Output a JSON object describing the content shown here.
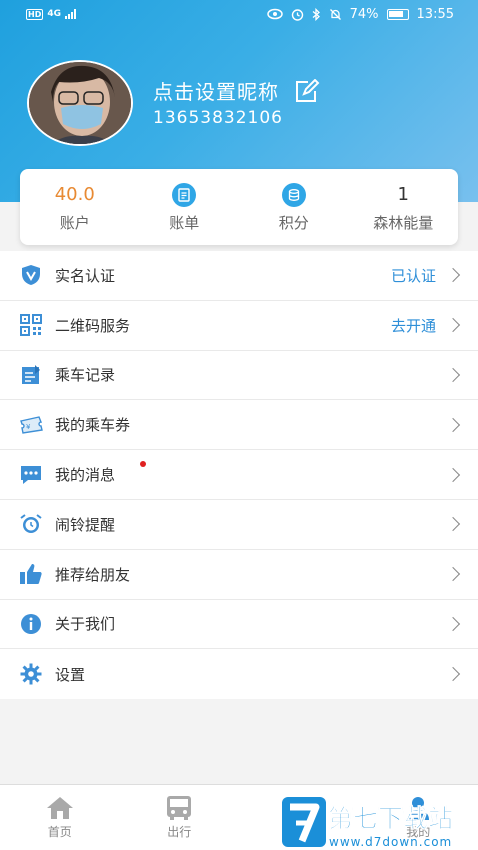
{
  "status_bar": {
    "network": "4G",
    "hd": "HD",
    "battery": "74%",
    "time": "13:55"
  },
  "profile": {
    "nickname": "点击设置昵称",
    "phone": "13653832106"
  },
  "stats": [
    {
      "value": "40.0",
      "label": "账户"
    },
    {
      "label": "账单",
      "icon": "receipt-icon"
    },
    {
      "label": "积分",
      "icon": "coins-icon"
    },
    {
      "value": "1",
      "label": "森林能量"
    }
  ],
  "menu": [
    {
      "label": "实名认证",
      "status": "已认证",
      "icon": "shield-v-icon"
    },
    {
      "label": "二维码服务",
      "status": "去开通",
      "icon": "qr-code-icon"
    },
    {
      "label": "乘车记录",
      "icon": "notebook-icon"
    },
    {
      "label": "我的乘车券",
      "icon": "ticket-icon"
    },
    {
      "label": "我的消息",
      "icon": "message-icon",
      "has_unread_dot": true
    },
    {
      "label": "闹铃提醒",
      "icon": "alarm-clock-icon"
    },
    {
      "label": "推荐给朋友",
      "icon": "thumbs-up-icon"
    },
    {
      "label": "关于我们",
      "icon": "info-icon"
    },
    {
      "label": "设置",
      "icon": "gear-icon"
    }
  ],
  "tabs": [
    {
      "label": "首页",
      "icon": "home-icon"
    },
    {
      "label": "出行",
      "icon": "bus-icon"
    },
    {
      "label": "",
      "icon": "wallet-icon"
    },
    {
      "label": "我的",
      "icon": "user-icon",
      "active": true
    }
  ],
  "watermark": {
    "brand": "第七下载站",
    "url": "www.d7down.com"
  },
  "colors": {
    "header": "#1fa0de",
    "accent": "#2fa6e6",
    "status_link": "#2f8fd8",
    "balance": "#e88a33",
    "unread": "#e02020"
  }
}
